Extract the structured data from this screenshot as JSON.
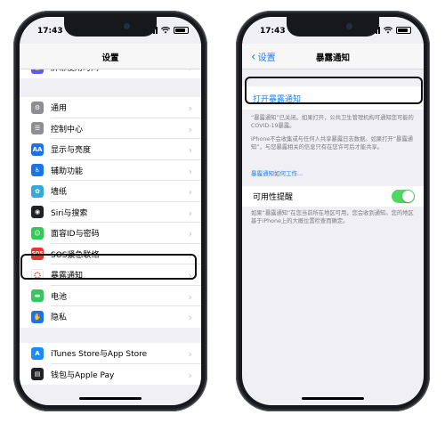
{
  "left": {
    "time": "17:43",
    "nav_title": "设置",
    "partial_row": "屏幕使用时间",
    "items": [
      {
        "label": "通用",
        "icon": "gear-icon",
        "color": "#8e8e93"
      },
      {
        "label": "控制中心",
        "icon": "control-center-icon",
        "color": "#8e8e93"
      },
      {
        "label": "显示与亮度",
        "icon": "display-aa-icon",
        "color": "#1a73e8"
      },
      {
        "label": "辅助功能",
        "icon": "accessibility-icon",
        "color": "#1a73e8"
      },
      {
        "label": "墙纸",
        "icon": "wallpaper-icon",
        "color": "#34aadc"
      },
      {
        "label": "Siri与搜索",
        "icon": "siri-icon",
        "color": "#222226"
      },
      {
        "label": "面容ID与密码",
        "icon": "face-id-icon",
        "color": "#34c759"
      },
      {
        "label": "SOS紧急联络",
        "icon": "sos-icon",
        "color": "#e0382f"
      },
      {
        "label": "暴露通知",
        "icon": "exposure-notification-icon",
        "color": "#ffffff"
      },
      {
        "label": "电池",
        "icon": "battery-icon",
        "color": "#34c759"
      },
      {
        "label": "隐私",
        "icon": "privacy-hand-icon",
        "color": "#1a73e8"
      }
    ],
    "items2": [
      {
        "label": "iTunes Store与App Store",
        "icon": "app-store-icon",
        "color": "#1a8cf5"
      },
      {
        "label": "钱包与Apple Pay",
        "icon": "wallet-icon",
        "color": "#222226"
      }
    ],
    "sos_text": "SOS",
    "aa_text": "AA"
  },
  "right": {
    "time": "17:43",
    "back_label": "设置",
    "nav_title": "暴露通知",
    "open_button": "打开暴露通知",
    "desc1": "“暴露通知”已关闭。如果打开，公共卫生管理机构可通知您可能的COVID-19暴露。",
    "desc2": "iPhone不会收集或与任何人共享暴露日志数据。如果打开“暴露通知”，与您暴露相关的信息只有在您许可后才能共享。",
    "how_link": "暴露通知如何工作...",
    "toggle_label": "可用性提醒",
    "toggle_on": true,
    "desc3": "如果“暴露通知”在您当前所在地区可用，您会收到通知。您的地区基于iPhone上的大概位置检查而确定。"
  }
}
